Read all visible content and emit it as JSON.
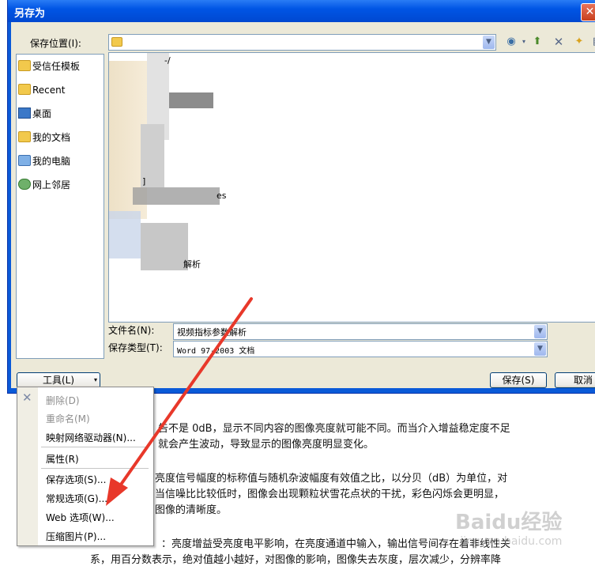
{
  "dialog": {
    "title": "另存为",
    "close_glyph": "✕",
    "save_in_label": "保存位置(I):",
    "save_in_value": "",
    "filename_label": "文件名(N):",
    "filename_value": "视频指标参数解析",
    "filetype_label": "保存类型(T):",
    "filetype_value": "Word 97-2003 文档",
    "tools_label": "工具(L)",
    "save_label": "保存(S)",
    "cancel_label": "取消"
  },
  "places": [
    {
      "label": "受信任模板",
      "icon": "folder-icon"
    },
    {
      "label": "Recent",
      "icon": "folder-icon"
    },
    {
      "label": "桌面",
      "icon": "desktop-icon"
    },
    {
      "label": "我的文档",
      "icon": "documents-icon"
    },
    {
      "label": "我的电脑",
      "icon": "computer-icon"
    },
    {
      "label": "网上邻居",
      "icon": "network-icon"
    }
  ],
  "file_fragments": {
    "a": "-/",
    "b": "]",
    "c": "es",
    "d": "解析"
  },
  "tools_menu": {
    "items": [
      {
        "label": "删除(D)",
        "disabled": true
      },
      {
        "label": "重命名(M)",
        "disabled": true
      },
      {
        "label": "映射网络驱动器(N)...",
        "disabled": false
      },
      {
        "label": "属性(R)",
        "disabled": false
      },
      {
        "label": "保存选项(S)...",
        "disabled": false
      },
      {
        "label": "常规选项(G)...",
        "disabled": false
      },
      {
        "label": "Web 选项(W)...",
        "disabled": false
      },
      {
        "label": "压缩图片(P)...",
        "disabled": false
      }
    ]
  },
  "document": {
    "lines": [
      "告不是 0dB，显示不同内容的图像亮度就可能不同。而当介入增益稳定度不足",
      "就会产生波动，导致显示的图像亮度明显变化。",
      "亮度信号幅度的标称值与随机杂波幅度有效值之比，以分贝（dB）为单位，对",
      "当信噪比比较低时，图像会出现颗粒状雪花点状的干扰，彩色闪烁会更明显，",
      "图像的清晰度。",
      "：亮度增益受亮度电平影响，在亮度通道中输入，输出信号间存在着非线性关",
      "系，用百分数表示，绝对值越小越好，对图像的影响，图像失去灰度，层次减少，分辨率降"
    ]
  },
  "watermark": {
    "main": "Baidu经验",
    "sub": "jingyan.baidu.com"
  },
  "colors": {
    "titlebar": "#0055e5",
    "dialog_bg": "#ece9d8",
    "arrow": "#e8382a"
  }
}
